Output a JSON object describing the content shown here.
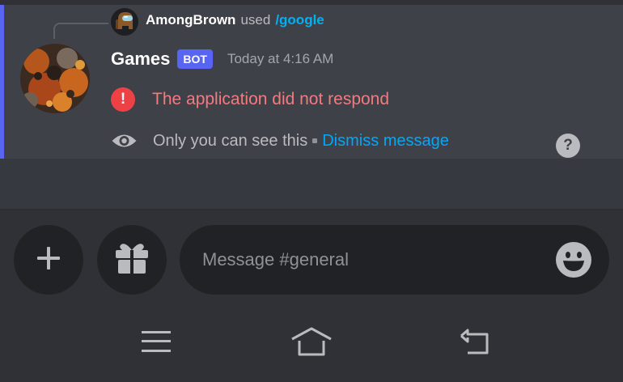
{
  "message": {
    "reply": {
      "username": "AmongBrown",
      "used_text": "used",
      "command": "/google"
    },
    "author": {
      "name": "Games",
      "badge": "BOT",
      "timestamp": "Today at 4:16 AM"
    },
    "error_icon_glyph": "!",
    "error_text": "The application did not respond",
    "ephemeral": {
      "notice": "Only you can see this",
      "dismiss_label": "Dismiss message",
      "help_glyph": "?"
    }
  },
  "composer": {
    "placeholder": "Message #general"
  },
  "icons": {
    "plus": "plus-icon",
    "gift": "gift-icon",
    "emoji": "emoji-icon",
    "menu": "menu-icon",
    "home": "home-icon",
    "back": "back-icon",
    "eye": "eye-icon",
    "error": "error-icon",
    "help": "help-icon"
  },
  "colors": {
    "accent": "#5865f2",
    "error": "#ed4245",
    "link": "#00a8fc",
    "command": "#00b0f4"
  }
}
